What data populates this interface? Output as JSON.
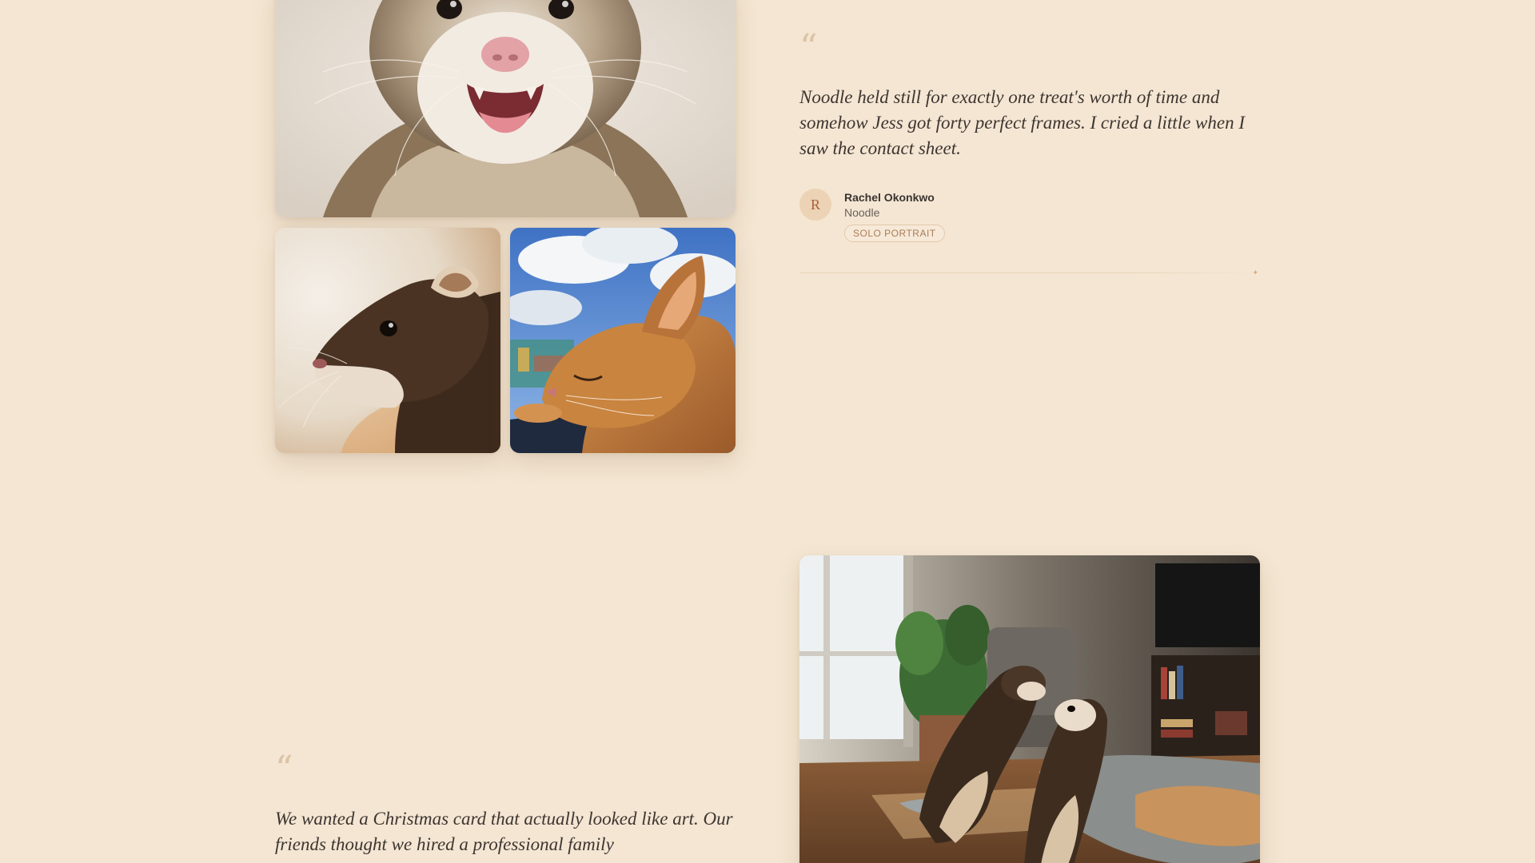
{
  "gallery": {
    "photos": [
      {
        "subject": "ferret-open-mouth-portrait"
      },
      {
        "subject": "ferret-profile-portrait"
      },
      {
        "subject": "orange-cat-sleeping"
      },
      {
        "subject": "two-ferrets-playing-indoors"
      }
    ]
  },
  "testimonials": [
    {
      "quote_mark": "“",
      "quote": "Noodle held still for exactly one treat's worth of time and somehow Jess got forty perfect frames. I cried a little when I saw the contact sheet.",
      "avatar_initial": "R",
      "name": "Rachel Okonkwo",
      "pet": "Noodle",
      "session": "SOLO PORTRAIT",
      "divider_icon": "✦"
    },
    {
      "quote_mark": "“",
      "quote": "We wanted a Christmas card that actually looked like art. Our friends thought we hired a professional family"
    }
  ],
  "colors": {
    "background": "#f4e6d3",
    "quote_mark": "#dcc3a4",
    "text": "#3d3530",
    "avatar_bg": "#ecd3b5",
    "avatar_text": "#a8643a",
    "badge_border": "#e3c8ab",
    "badge_text": "#a87d58"
  }
}
